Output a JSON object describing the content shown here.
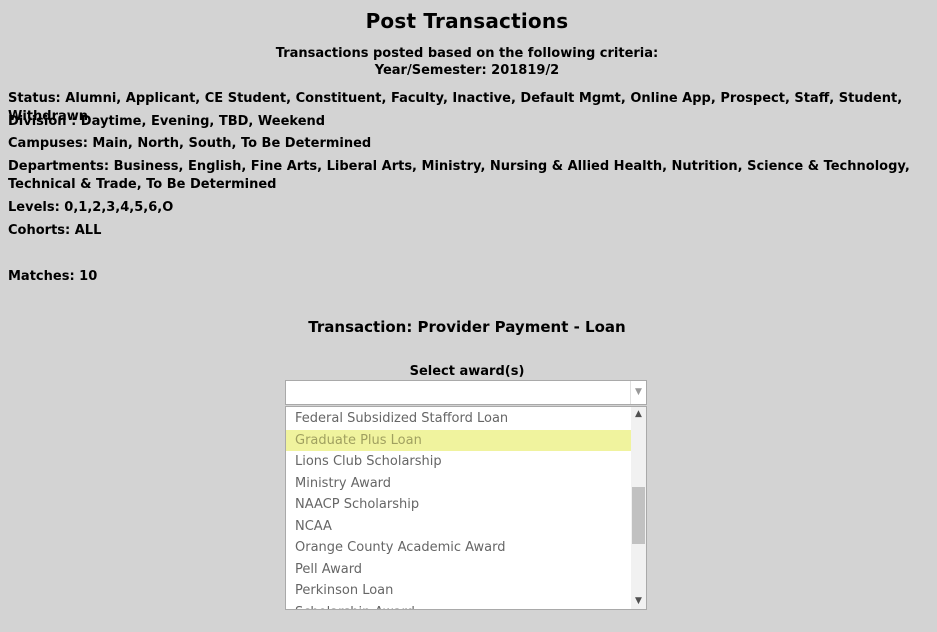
{
  "page": {
    "title": "Post Transactions",
    "criteria_intro": "Transactions posted based on the following criteria:",
    "year_semester": "Year/Semester: 201819/2"
  },
  "criteria": {
    "status": "Status: Alumni, Applicant, CE Student, Constituent, Faculty, Inactive, Default Mgmt, Online App, Prospect, Staff, Student, Withdrawn",
    "division": "Division : Daytime, Evening, TBD, Weekend",
    "campuses": "Campuses: Main, North, South, To Be Determined",
    "departments": "Departments: Business, English, Fine Arts, Liberal Arts, Ministry, Nursing & Allied Health, Nutrition, Science & Technology, Technical & Trade, To Be Determined",
    "levels": "Levels: 0,1,2,3,4,5,6,O",
    "cohorts": "Cohorts: ALL"
  },
  "matches": "Matches: 10",
  "transaction": {
    "label": "Transaction: Provider Payment - Loan"
  },
  "award_select": {
    "label": "Select award(s)",
    "value": "",
    "options": [
      "Federal Subsidized Stafford Loan",
      "Graduate Plus Loan",
      "Lions Club Scholarship",
      "Ministry Award",
      "NAACP Scholarship",
      "NCAA",
      "Orange County Academic Award",
      "Pell Award",
      "Perkinson Loan",
      "Scholarship Award"
    ],
    "highlighted_option": "Graduate Plus Loan"
  },
  "colors": {
    "background": "#d3d3d3",
    "highlight": "#f0f39e"
  }
}
